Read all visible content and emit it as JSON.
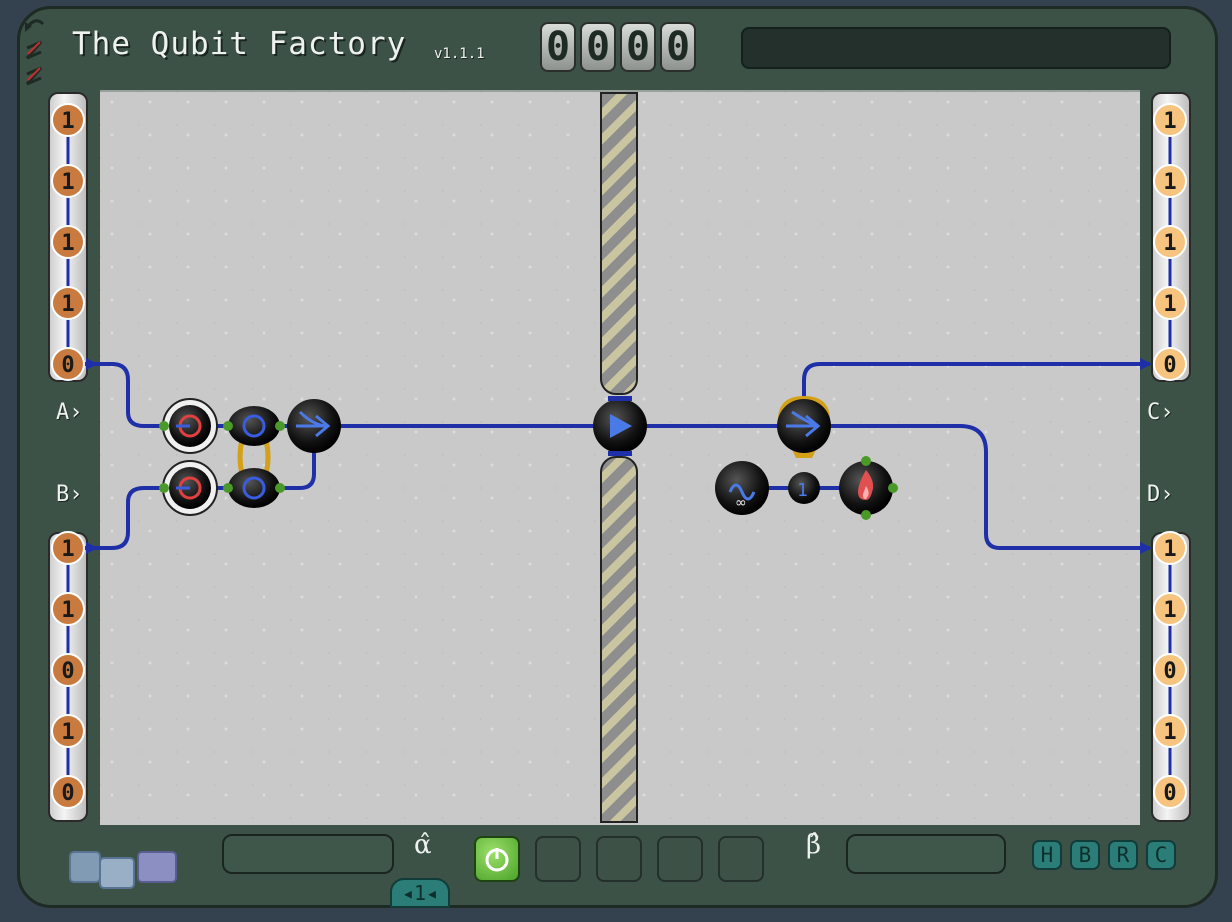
{
  "title": "The Qubit Factory",
  "version": "v1.1.1",
  "score_digits": [
    "0",
    "0",
    "0",
    "0"
  ],
  "ports": {
    "left": [
      {
        "label": "A",
        "arrow": "›"
      },
      {
        "label": "B",
        "arrow": "›"
      }
    ],
    "right": [
      {
        "label": "C",
        "arrow": "›"
      },
      {
        "label": "D",
        "arrow": "›"
      }
    ]
  },
  "input_top_qubits": [
    "1",
    "1",
    "1",
    "1",
    "0"
  ],
  "input_bottom_qubits": [
    "1",
    "1",
    "0",
    "1",
    "0"
  ],
  "output_top_qubits": [
    "1",
    "1",
    "1",
    "1",
    "0"
  ],
  "output_bottom_qubits": [
    "1",
    "1",
    "0",
    "1",
    "0"
  ],
  "alpha_mark": "α̂",
  "beta_mark": "β̂",
  "page_indicator": "1",
  "tool_buttons": [
    "H",
    "B",
    "R",
    "C"
  ],
  "colors": {
    "qubit_input": "#c97b3f",
    "qubit_output": "#f6c47f",
    "wire": "#1f2fa8",
    "gold": "#d4a017",
    "power": "#5fb535",
    "teal": "#2b7d78"
  },
  "icons": [
    "undo-icon",
    "spin-icon",
    "power-icon",
    "flame-icon",
    "infinity-icon",
    "splitter-icon",
    "qubit-one-icon"
  ]
}
